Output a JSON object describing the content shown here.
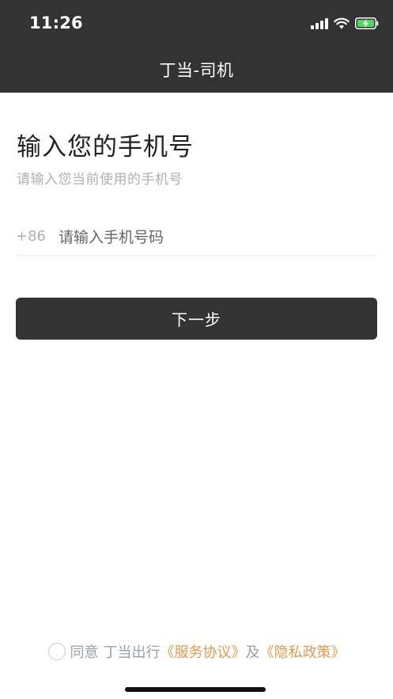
{
  "status_bar": {
    "time": "11:26",
    "icons": [
      "signal-icon",
      "wifi-icon",
      "battery-charging-icon"
    ]
  },
  "nav": {
    "title": "丁当-司机"
  },
  "main": {
    "title": "输入您的手机号",
    "subtitle": "请输入您当前使用的手机号",
    "country_code": "+86",
    "phone_placeholder": "请输入手机号码",
    "phone_value": "",
    "next_button_label": "下一步"
  },
  "agreement": {
    "prefix": "同意",
    "brand": "丁当出行",
    "service_link": "《服务协议》",
    "conjunction": "及",
    "privacy_link": "《隐私政策》"
  },
  "colors": {
    "header_bg": "#333333",
    "button_bg": "#333333",
    "link": "#e39a4f",
    "muted_text": "#9aa0aa",
    "battery_charging": "#4cd964"
  }
}
